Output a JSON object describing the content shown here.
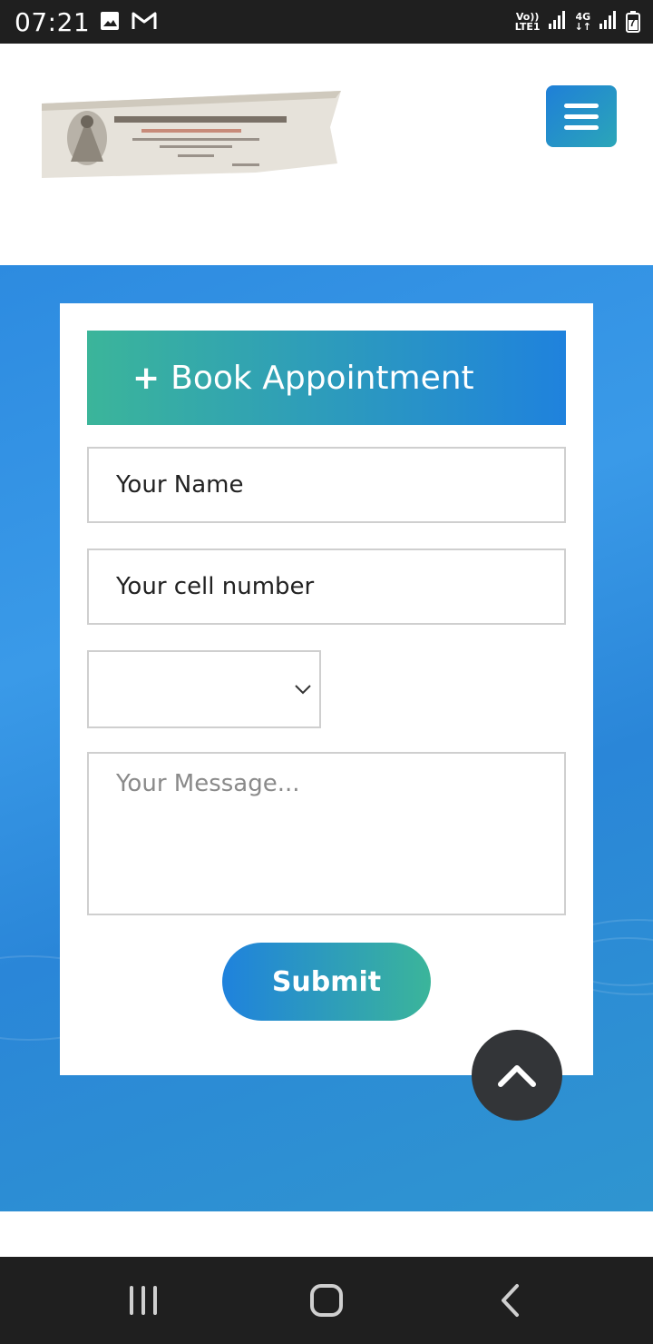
{
  "status_bar": {
    "time": "07:21",
    "icons": [
      "image-icon",
      "gmail-icon",
      "volte-icon",
      "signal-icon",
      "4g-icon",
      "signal-icon",
      "battery-icon"
    ],
    "volte_label_top": "Vo))",
    "volte_label_bottom": "LTE1",
    "network_label": "4G",
    "battery_label": "7"
  },
  "header": {
    "logo_alt": "logo image",
    "menu_icon": "hamburger-icon"
  },
  "appointment_form": {
    "title_icon": "+",
    "title": "Book Appointment",
    "name_placeholder": "Your Name",
    "cell_placeholder": "Your cell number",
    "select_value": "",
    "message_placeholder": "Your Message...",
    "submit_label": "Submit"
  },
  "scroll_to_top": {
    "icon": "chevron-up-icon"
  },
  "navigation_bar": {
    "icons": [
      "recents-icon",
      "home-icon",
      "back-icon"
    ]
  },
  "colors": {
    "status_bar_bg": "#1f1f1f",
    "hero_blue": "#2d8be0",
    "gradient_green": "#3bb59a",
    "gradient_blue": "#1f82dd",
    "scroll_top_bg": "#333538"
  }
}
